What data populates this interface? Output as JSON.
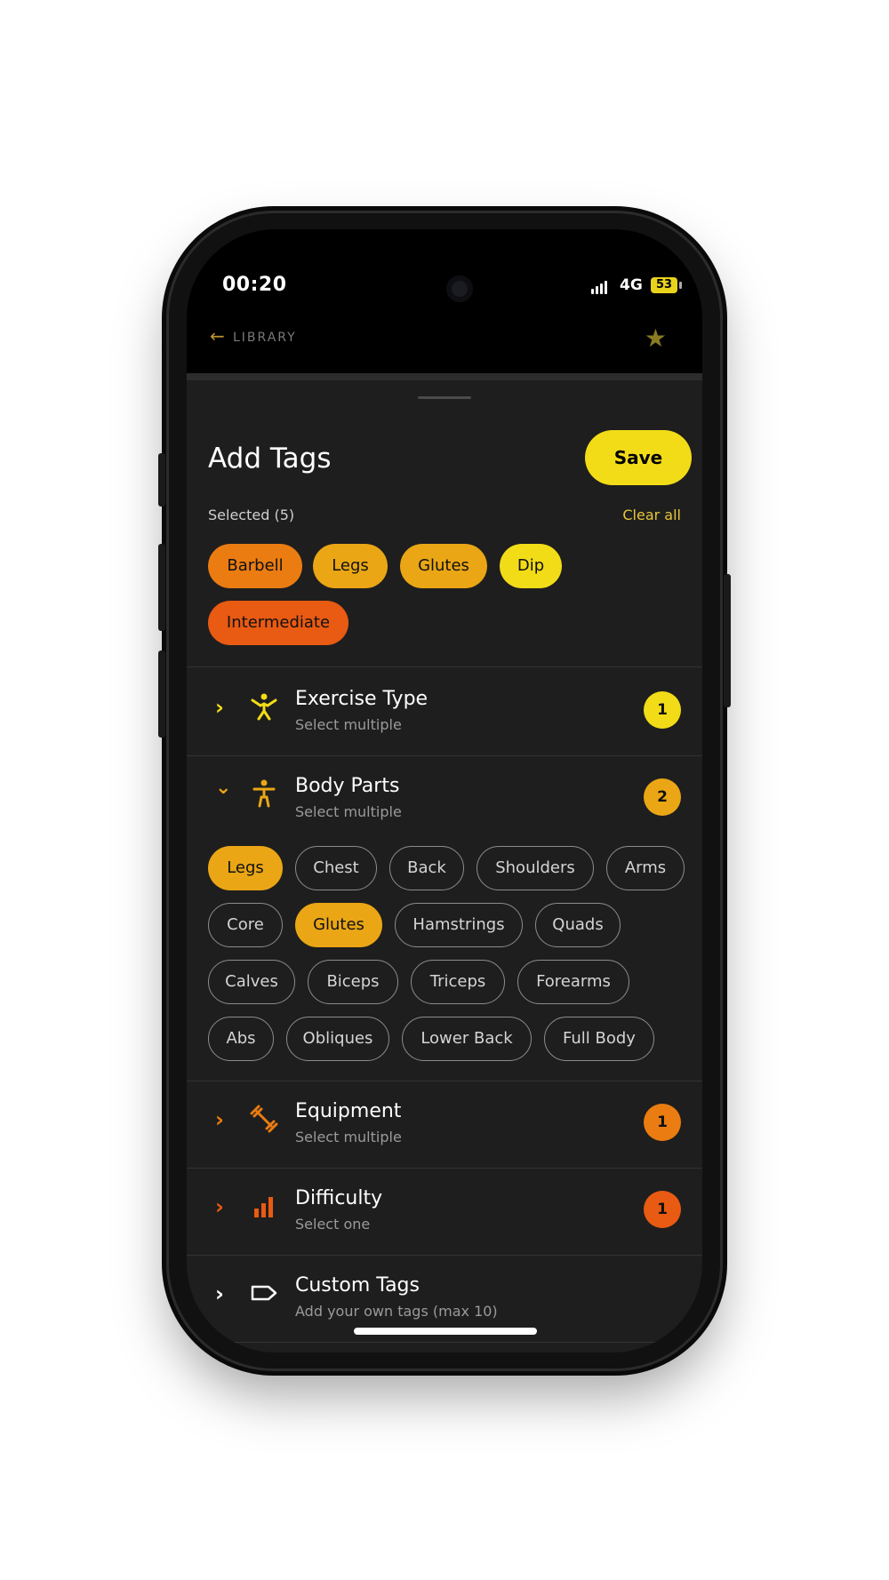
{
  "status_bar": {
    "time": "00:20",
    "network": "4G",
    "battery": "53"
  },
  "nav": {
    "back_label": "LIBRARY",
    "back_icon": "arrow-left-icon",
    "star_icon": "star-icon"
  },
  "sheet": {
    "title": "Add Tags",
    "save_label": "Save",
    "selected_label": "Selected (5)",
    "clear_all_label": "Clear all"
  },
  "selected_tags": [
    {
      "label": "Barbell",
      "color": "#ea7c12"
    },
    {
      "label": "Legs",
      "color": "#eaa615"
    },
    {
      "label": "Glutes",
      "color": "#eaa615"
    },
    {
      "label": "Dip",
      "color": "#f2dc17"
    },
    {
      "label": "Intermediate",
      "color": "#e95a12"
    }
  ],
  "sections": [
    {
      "title": "Exercise Type",
      "subtitle": "Select multiple",
      "count": "1",
      "color": "#f2dc17",
      "icon": "gymnast-icon",
      "expanded": false
    },
    {
      "title": "Body Parts",
      "subtitle": "Select multiple",
      "count": "2",
      "color": "#eaa615",
      "icon": "person-icon",
      "expanded": true
    },
    {
      "title": "Equipment",
      "subtitle": "Select multiple",
      "count": "1",
      "color": "#ea7c12",
      "icon": "dumbbell-icon",
      "expanded": false
    },
    {
      "title": "Difficulty",
      "subtitle": "Select one",
      "count": "1",
      "color": "#e95a12",
      "icon": "bars-icon",
      "expanded": false
    },
    {
      "title": "Custom Tags",
      "subtitle": "Add your own tags (max 10)",
      "count": "",
      "color": "#ffffff",
      "icon": "tag-icon",
      "expanded": false
    }
  ],
  "body_parts": [
    {
      "label": "Legs",
      "selected": true
    },
    {
      "label": "Chest",
      "selected": false
    },
    {
      "label": "Back",
      "selected": false
    },
    {
      "label": "Shoulders",
      "selected": false
    },
    {
      "label": "Arms",
      "selected": false
    },
    {
      "label": "Core",
      "selected": false
    },
    {
      "label": "Glutes",
      "selected": true
    },
    {
      "label": "Hamstrings",
      "selected": false
    },
    {
      "label": "Quads",
      "selected": false
    },
    {
      "label": "Calves",
      "selected": false
    },
    {
      "label": "Biceps",
      "selected": false
    },
    {
      "label": "Triceps",
      "selected": false
    },
    {
      "label": "Forearms",
      "selected": false
    },
    {
      "label": "Abs",
      "selected": false
    },
    {
      "label": "Obliques",
      "selected": false
    },
    {
      "label": "Lower Back",
      "selected": false
    },
    {
      "label": "Full Body",
      "selected": false
    }
  ]
}
